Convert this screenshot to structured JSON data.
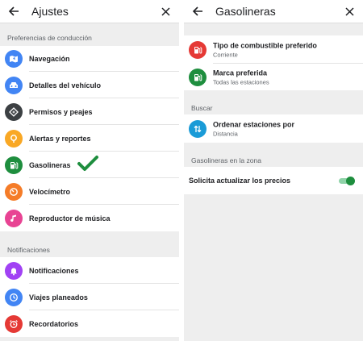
{
  "left": {
    "title": "Ajustes",
    "section_driving": "Preferencias de conducción",
    "driving_items": [
      {
        "label": "Navegación",
        "color": "#4285f4"
      },
      {
        "label": "Detalles del vehículo",
        "color": "#4285f4"
      },
      {
        "label": "Permisos y peajes",
        "color": "#3c4043"
      },
      {
        "label": "Alertas y reportes",
        "color": "#f9a825"
      },
      {
        "label": "Gasolineras",
        "color": "#1e8e3e"
      },
      {
        "label": "Velocímetro",
        "color": "#f57c28"
      },
      {
        "label": "Reproductor de música",
        "color": "#e84393"
      }
    ],
    "section_notifications": "Notificaciones",
    "notification_items": [
      {
        "label": "Notificaciones",
        "color": "#a142f4"
      },
      {
        "label": "Viajes planeados",
        "color": "#4285f4"
      },
      {
        "label": "Recordatorios",
        "color": "#e53935"
      }
    ]
  },
  "right": {
    "title": "Gasolineras",
    "fuel_type": {
      "label": "Tipo de combustible preferido",
      "value": "Corriente",
      "color": "#e53935"
    },
    "brand": {
      "label": "Marca preferida",
      "value": "Todas las estaciones",
      "color": "#1e8e3e"
    },
    "section_search": "Buscar",
    "sort": {
      "label": "Ordenar estaciones por",
      "value": "Distancia",
      "color": "#1a9bd7"
    },
    "section_zone": "Gasolineras en la zona",
    "update_prices": {
      "label": "Solicita actualizar los precios",
      "enabled": true
    }
  },
  "colors": {
    "checkmark": "#1e8e3e",
    "toggle_on": "#1e8e3e"
  }
}
